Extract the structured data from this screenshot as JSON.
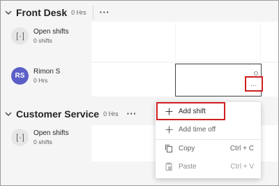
{
  "groups": [
    {
      "title": "Front Desk",
      "hours": "0 Hrs",
      "rows": [
        {
          "avatar": "open-shifts-icon",
          "name": "Open shifts",
          "sub": "0 shifts"
        },
        {
          "avatar_initials": "RS",
          "name": "Rimon S",
          "sub": "0 Hrs"
        }
      ]
    },
    {
      "title": "Customer Service",
      "hours": "0 Hrs",
      "rows": [
        {
          "avatar": "open-shifts-icon",
          "name": "Open shifts",
          "sub": "0 shifts"
        }
      ]
    }
  ],
  "cell_more_label": "...",
  "group_more_label": "···",
  "context_menu": {
    "items": [
      {
        "icon": "plus-icon",
        "label": "Add shift",
        "shortcut": ""
      },
      {
        "icon": "plus-icon",
        "label": "Add time off",
        "shortcut": ""
      },
      {
        "icon": "copy-icon",
        "label": "Copy",
        "shortcut": "Ctrl + C"
      },
      {
        "icon": "paste-icon",
        "label": "Paste",
        "shortcut": "Ctrl + V"
      }
    ]
  },
  "colors": {
    "avatar_rs": "#5b5fc7",
    "highlight": "#d01f1f"
  }
}
